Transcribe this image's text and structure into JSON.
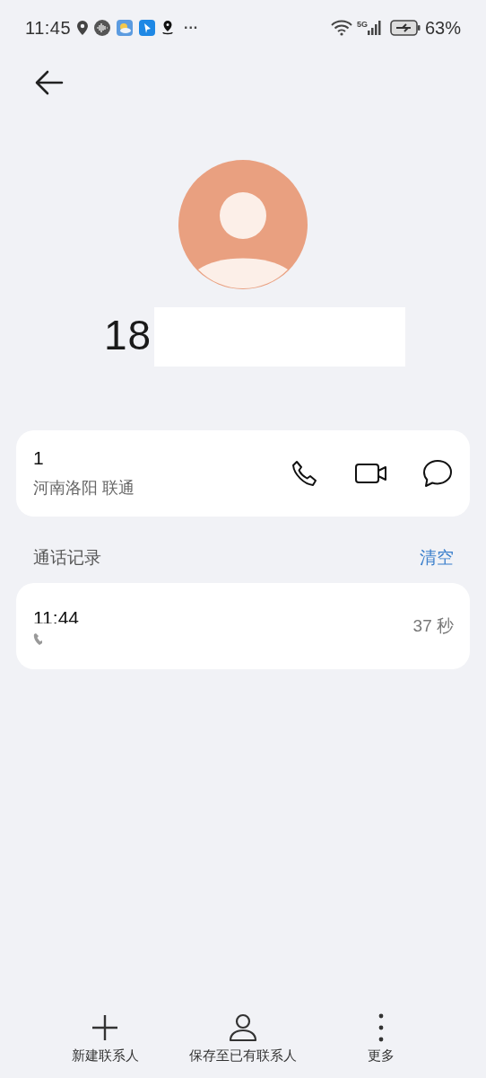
{
  "status_bar": {
    "time": "11:45",
    "more": "···",
    "network": "5G",
    "battery": "63%"
  },
  "contact": {
    "number": "18"
  },
  "number_card": {
    "number": "1",
    "location": "河南洛阳 联通"
  },
  "call_log": {
    "title": "通话记录",
    "clear": "清空",
    "entries": [
      {
        "time": "11:44",
        "duration": "37 秒"
      }
    ]
  },
  "bottom_actions": [
    {
      "kind": "add",
      "label": "新建联系人"
    },
    {
      "kind": "person",
      "label": "保存至已有联系人"
    },
    {
      "kind": "more",
      "label": "更多"
    }
  ]
}
